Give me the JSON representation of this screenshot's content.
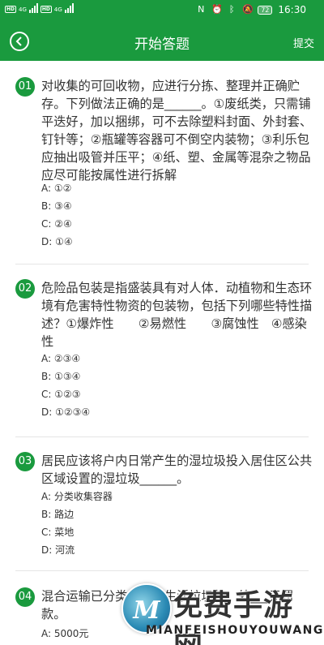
{
  "status_bar": {
    "network_left": "4G",
    "network_right": "4G",
    "battery": "72",
    "time": "16:30"
  },
  "header": {
    "title": "开始答题",
    "submit_label": "提交"
  },
  "questions": [
    {
      "num": "01",
      "text": "对收集的可回收物，应进行分拣、整理并正确贮存。下列做法正确的是______。①废纸类，只需铺平迭好，加以捆绑，可不去除塑料封面、外封套、钉针等；②瓶罐等容器可不倒空内装物；③利乐包应抽出吸管并压平；④纸、塑、金属等混杂之物品应尽可能按属性进行拆解",
      "options": [
        "A: ①②",
        "B: ③④",
        "C: ②④",
        "D: ①④"
      ]
    },
    {
      "num": "02",
      "text": "危险品包装是指盛装具有对人体．动植物和生态环境有危害特性物资的包装物，包括下列哪些特性描述？①爆炸性　　②易燃性　　③腐蚀性　④感染性",
      "options": [
        "A: ②③④",
        "B: ①③④",
        "C: ①②③",
        "D: ①②③④"
      ]
    },
    {
      "num": "03",
      "text": "居民应该将户内日常产生的湿垃圾投入居住区公共区域设置的湿垃圾______。",
      "options": [
        "A: 分类收集容器",
        "B: 路边",
        "C: 菜地",
        "D: 河流"
      ]
    },
    {
      "num": "04",
      "text": "混合运输已分类收集的生活垃圾的，处___元罚款。",
      "options": [
        "A: 5000元"
      ]
    }
  ],
  "watermark": {
    "logo_letter": "M",
    "title": "免费手游网",
    "subtitle": "MIANFEISHOUYOUWANG"
  }
}
